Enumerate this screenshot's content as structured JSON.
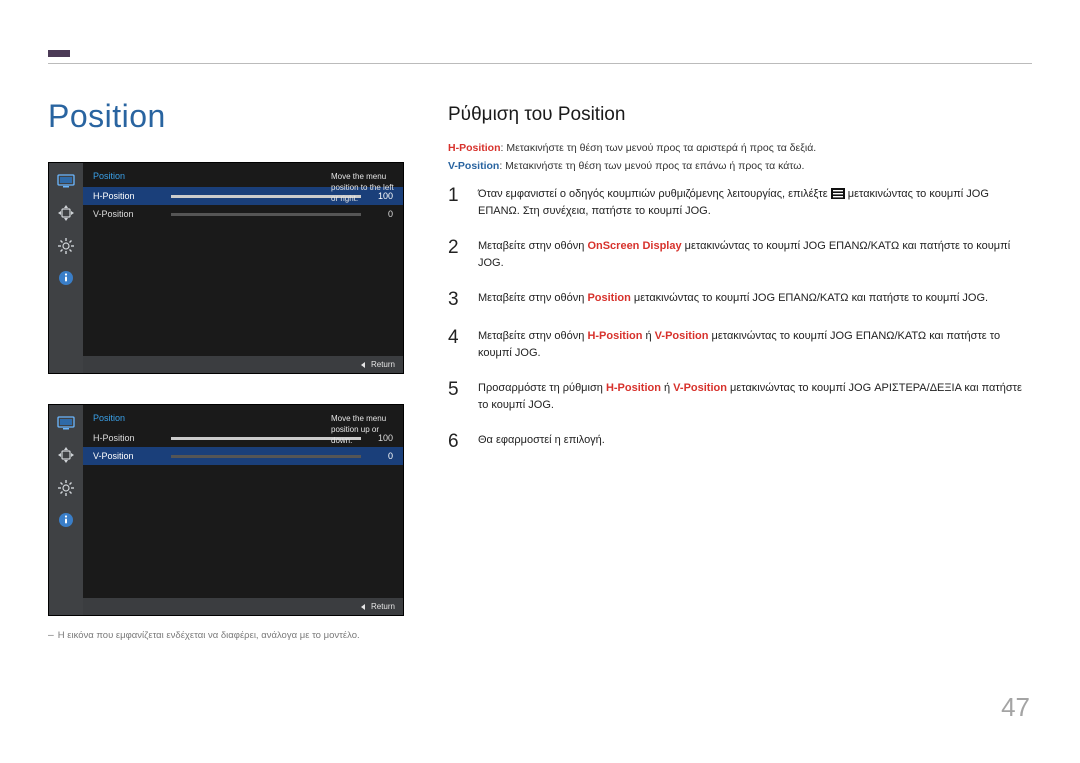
{
  "page_number": "47",
  "title": "Position",
  "sub_title": "Ρύθμιση του Position",
  "defs": {
    "h_term": "H-Position",
    "h_text": ": Μετακινήστε τη θέση των μενού προς τα αριστερά ή προς τα δεξιά.",
    "v_term": "V-Position",
    "v_text": ": Μετακινήστε τη θέση των μενού προς τα επάνω ή προς τα κάτω."
  },
  "steps": [
    {
      "num": "1",
      "parts": [
        {
          "t": "Όταν εμφανιστεί ο οδηγός κουμπιών ρυθμιζόμενης λειτουργίας, επιλέξτε "
        },
        {
          "icon": "menu"
        },
        {
          "t": " μετακινώντας το κουμπί JOG ΕΠΑΝΩ. Στη συνέχεια, πατήστε το κουμπί JOG."
        }
      ]
    },
    {
      "num": "2",
      "parts": [
        {
          "t": "Μεταβείτε στην οθόνη "
        },
        {
          "t": "OnScreen Display",
          "cls": "c-red term"
        },
        {
          "t": " μετακινώντας το κουμπί JOG ΕΠΑΝΩ/ΚΑΤΩ και πατήστε το κουμπί JOG."
        }
      ]
    },
    {
      "num": "3",
      "parts": [
        {
          "t": "Μεταβείτε στην οθόνη "
        },
        {
          "t": "Position",
          "cls": "c-red term"
        },
        {
          "t": " μετακινώντας το κουμπί JOG ΕΠΑΝΩ/ΚΑΤΩ και πατήστε το κουμπί JOG."
        }
      ]
    },
    {
      "num": "4",
      "parts": [
        {
          "t": "Μεταβείτε στην οθόνη "
        },
        {
          "t": "H-Position",
          "cls": "c-red term"
        },
        {
          "t": " ή "
        },
        {
          "t": "V-Position",
          "cls": "c-red term"
        },
        {
          "t": " μετακινώντας το κουμπί JOG ΕΠΑΝΩ/ΚΑΤΩ και πατήστε το κουμπί JOG."
        }
      ]
    },
    {
      "num": "5",
      "parts": [
        {
          "t": "Προσαρμόστε τη ρύθμιση "
        },
        {
          "t": "H-Position",
          "cls": "c-red term"
        },
        {
          "t": " ή "
        },
        {
          "t": "V-Position",
          "cls": "c-red term"
        },
        {
          "t": " μετακινώντας το κουμπί JOG ΑΡΙΣΤΕΡΑ/ΔΕΞΙΑ και πατήστε το κουμπί JOG."
        }
      ]
    },
    {
      "num": "6",
      "parts": [
        {
          "t": "Θα εφαρμοστεί η επιλογή."
        }
      ]
    }
  ],
  "osd": {
    "title": "Position",
    "h_label": "H-Position",
    "v_label": "V-Position",
    "h_value": "100",
    "v_value": "0",
    "help_h": "Move the menu position to the left or right.",
    "help_v": "Move the menu position up or down.",
    "return": "Return"
  },
  "note": "Η εικόνα που εμφανίζεται ενδέχεται να διαφέρει, ανάλογα με το μοντέλο."
}
